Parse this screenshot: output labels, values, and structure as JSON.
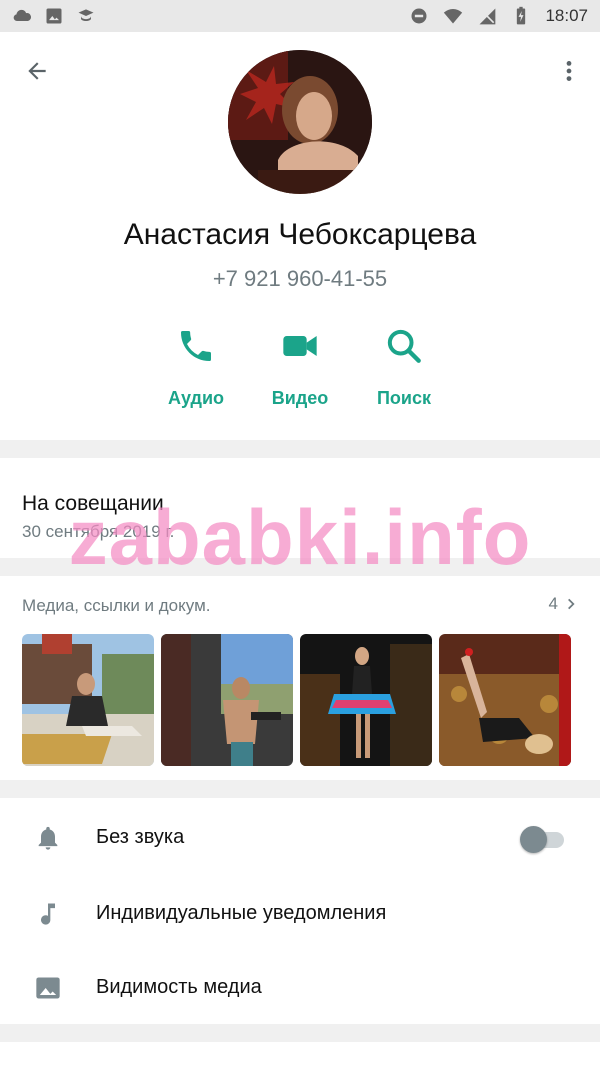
{
  "status_bar": {
    "time": "18:07"
  },
  "contact": {
    "name": "Анастасия Чебоксарцева",
    "phone": "+7 921 960-41-55"
  },
  "actions": [
    {
      "label": "Аудио",
      "icon": "phone-icon"
    },
    {
      "label": "Видео",
      "icon": "video-icon"
    },
    {
      "label": "Поиск",
      "icon": "search-icon"
    }
  ],
  "about": {
    "status": "На совещании",
    "date": "30 сентября 2019 г."
  },
  "media": {
    "title": "Медиа, ссылки и докум.",
    "count": "4"
  },
  "settings": [
    {
      "label": "Без звука",
      "icon": "bell-icon",
      "toggle": false
    },
    {
      "label": "Индивидуальные уведомления",
      "icon": "music-note-icon"
    },
    {
      "label": "Видимость медиа",
      "icon": "image-icon"
    }
  ],
  "watermark": "zababki.info",
  "colors": {
    "accent": "#1ba48a",
    "muted": "#6f7b80",
    "background": "#f0f0f0"
  }
}
